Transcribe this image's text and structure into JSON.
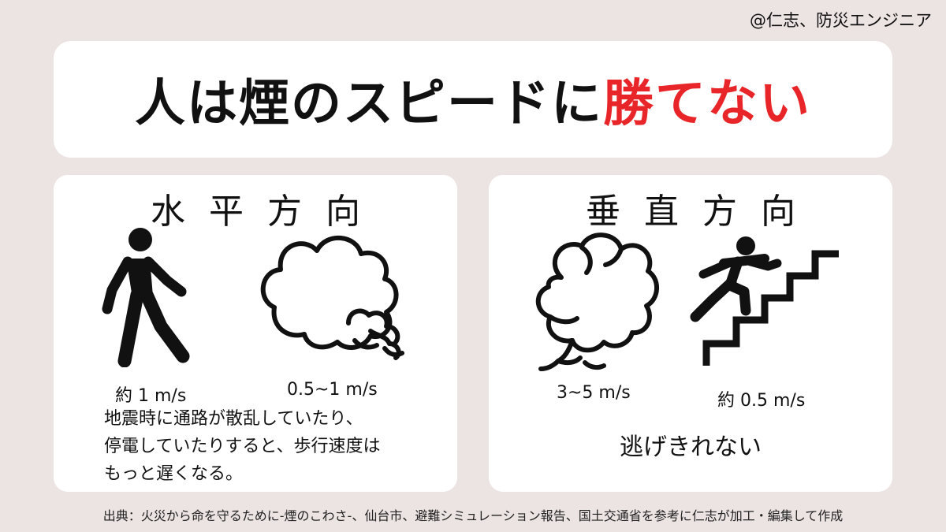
{
  "credit": "@仁志、防災エンジニア",
  "title": {
    "main": "人は煙のスピードに",
    "accent": "勝てない",
    "accent_color": "#e8262a"
  },
  "horizontal": {
    "heading": "水平方向",
    "person_speed": "約 1 m/s",
    "smoke_speed": "0.5~1 m/s",
    "note_lines": [
      "地震時に通路が散乱していたり、",
      "停電していたりすると、歩行速度は",
      "もっと遅くなる。"
    ],
    "icons": [
      "walking-person-icon",
      "smoke-cloud-icon"
    ]
  },
  "vertical": {
    "heading": "垂直方向",
    "smoke_speed": "3~5 m/s",
    "person_speed": "約 0.5 m/s",
    "conclusion": "逃げきれない",
    "icons": [
      "rising-smoke-icon",
      "person-climbing-stairs-icon"
    ]
  },
  "source": "出典：火災から命を守るために-煙のこわさ-、仙台市、避難シミュレーション報告、国土交通省を参考に仁志が加工・編集して作成"
}
